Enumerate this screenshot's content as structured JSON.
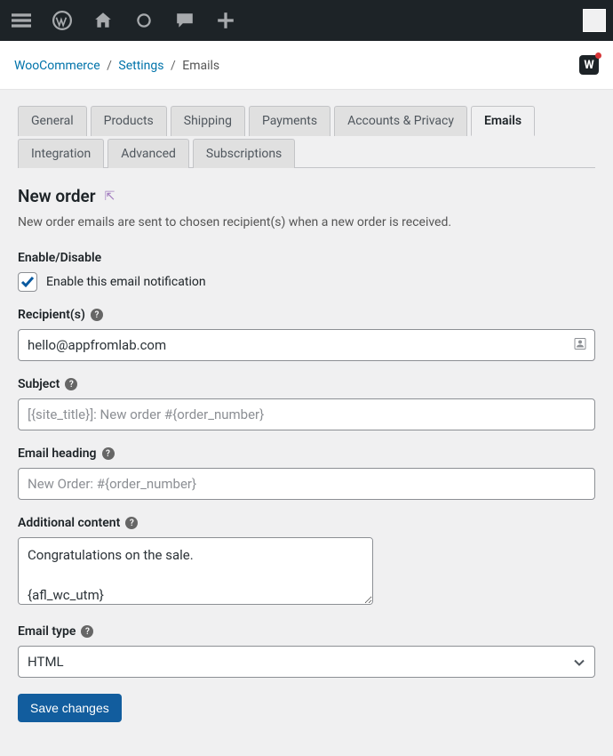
{
  "breadcrumb": {
    "root": "WooCommerce",
    "settings": "Settings",
    "current": "Emails"
  },
  "badge": "W",
  "tabs": [
    "General",
    "Products",
    "Shipping",
    "Payments",
    "Accounts & Privacy",
    "Emails",
    "Integration",
    "Advanced",
    "Subscriptions"
  ],
  "active_tab_index": 5,
  "section": {
    "title": "New order",
    "desc": "New order emails are sent to chosen recipient(s) when a new order is received."
  },
  "enable": {
    "label": "Enable/Disable",
    "checkbox_label": "Enable this email notification",
    "checked": true
  },
  "recipient": {
    "label": "Recipient(s)",
    "value": "hello@appfromlab.com"
  },
  "subject": {
    "label": "Subject",
    "placeholder": "[{site_title}]: New order #{order_number}"
  },
  "heading": {
    "label": "Email heading",
    "placeholder": "New Order: #{order_number}"
  },
  "additional": {
    "label": "Additional content",
    "value": "Congratulations on the sale.\n\n{afl_wc_utm}"
  },
  "email_type": {
    "label": "Email type",
    "value": "HTML"
  },
  "save_label": "Save changes"
}
